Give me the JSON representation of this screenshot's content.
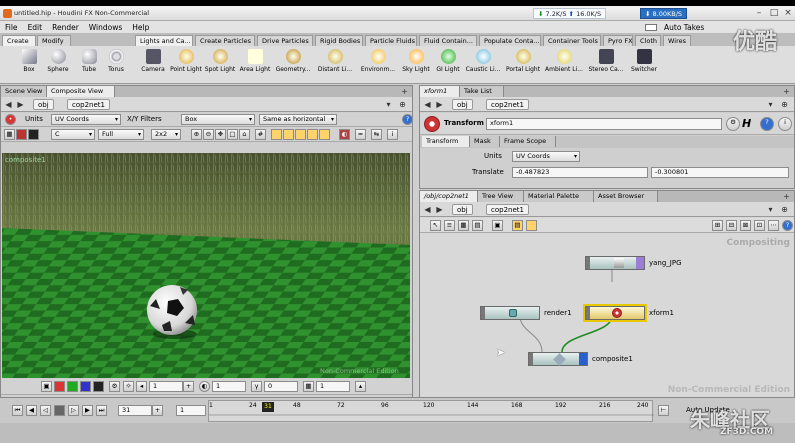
{
  "window": {
    "title": "untitled.hip - Houdini FX Non-Commercial"
  },
  "taskbar": {
    "down_speed": "7.2K/S",
    "up_speed": "16.0K/S",
    "net_speed": "8.00KB/S"
  },
  "menu": [
    "File",
    "Edit",
    "Render",
    "Windows",
    "Help"
  ],
  "auto_takes": "Auto Takes",
  "shelf_tabs_left": [
    "Create",
    "Modify"
  ],
  "shelf_tabs_right": [
    "Lights and Ca...",
    "Create Particles",
    "Drive Particles",
    "Rigid Bodies",
    "Particle Fluids",
    "Fluid Contain...",
    "Populate Conta...",
    "Container Tools",
    "Pyro FX",
    "Cloth",
    "Wires"
  ],
  "tools_left": [
    "Box",
    "Sphere",
    "Tube",
    "Torus"
  ],
  "tools_right": [
    "Camera",
    "Point Light",
    "Spot Light",
    "Area Light",
    "Geometry...",
    "Distant Li...",
    "Environm...",
    "Sky Light",
    "GI Light",
    "Caustic Li...",
    "Portal Light",
    "Ambient Li...",
    "Stereo Ca...",
    "Switcher"
  ],
  "left_panel": {
    "tabs": [
      "Scene View",
      "Composite View"
    ],
    "path": [
      "obj",
      "cop2net1"
    ],
    "units_label": "Units",
    "units_value": "UV Coords",
    "xy_filters_label": "X/Y Filters",
    "xy_value": "Box",
    "aspect_value": "Same as horizontal",
    "channel": "C",
    "resolution": "Full",
    "zoom": "2x2",
    "image_name": "composite1",
    "nce": "Non-Commercial Edition"
  },
  "param_panel": {
    "tabs": [
      "xform1",
      "Take List"
    ],
    "path": [
      "obj",
      "cop2net1"
    ],
    "op_type": "Transform",
    "op_name": "xform1",
    "subtabs": [
      "Transform",
      "Mask",
      "Frame Scope"
    ],
    "units_label": "Units",
    "units_value": "UV Coords",
    "translate_label": "Translate",
    "translate_x": "-0.487823",
    "translate_y": "-0.300801"
  },
  "network_panel": {
    "tabs": [
      "/obj/cop2net1",
      "Tree View",
      "Material Palette",
      "Asset Browser"
    ],
    "path": [
      "obj",
      "cop2net1"
    ],
    "context": "Compositing",
    "nce": "Non-Commercial Edition",
    "nodes": {
      "yang": "yang_JPG",
      "render": "render1",
      "xform": "xform1",
      "composite": "composite1"
    }
  },
  "viewer_bottom": {
    "v1": "1",
    "v2": "1",
    "v3": "0",
    "v4": "1"
  },
  "timeline": {
    "current_frame": "31",
    "start": "1",
    "ticks": [
      "1",
      "24",
      "48",
      "72",
      "96",
      "120",
      "144",
      "168",
      "192",
      "216",
      "240"
    ],
    "auto_update": "Auto Update"
  },
  "watermarks": {
    "top": "优酷",
    "bottom": "朱峰社区",
    "bottom_url": "ZF3D.COM"
  },
  "colors": {
    "grass": "#5b6b3a",
    "checker_a": "#2f8a2f",
    "checker_b": "#1a5e1a",
    "node_sel": "#e8c800",
    "accent_red": "#d44"
  }
}
